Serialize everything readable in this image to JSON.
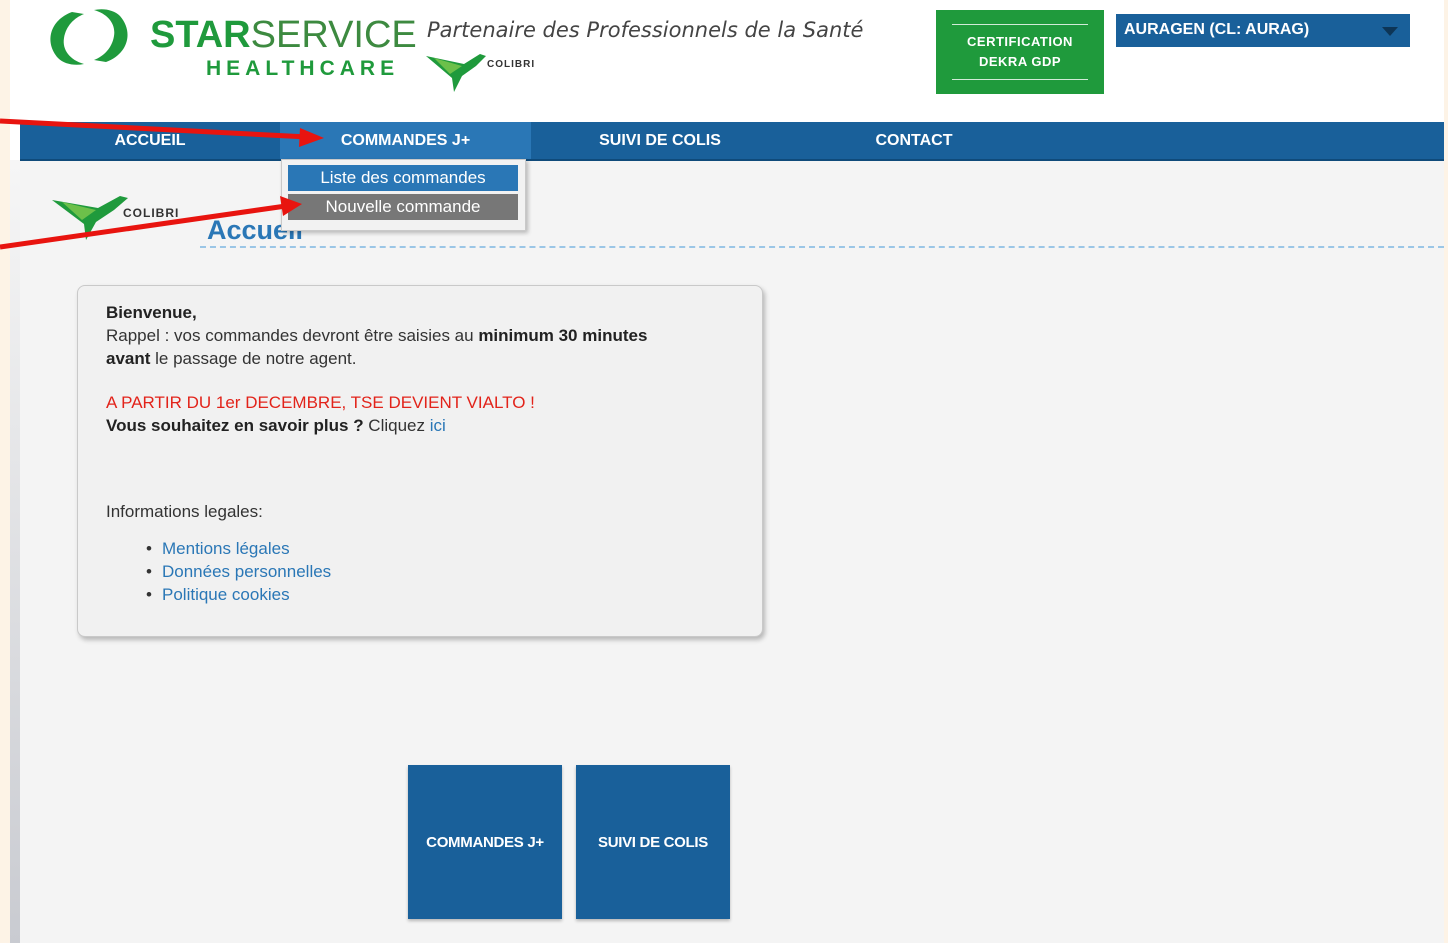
{
  "header": {
    "brand_star": "STAR",
    "brand_service": "SERVICE",
    "brand_healthcare": "HEALTHCARE",
    "tagline": "Partenaire des Professionnels de la Santé",
    "colibri_label": "COLIBRI",
    "certification_line1": "CERTIFICATION",
    "certification_line2": "DEKRA GDP",
    "account_selector": "AURAGEN (CL: AURAG)"
  },
  "nav": {
    "items": [
      {
        "label": "ACCUEIL"
      },
      {
        "label": "COMMANDES J+"
      },
      {
        "label": "SUIVI DE COLIS"
      },
      {
        "label": "CONTACT"
      }
    ],
    "dropdown": [
      {
        "label": "Liste des commandes"
      },
      {
        "label": "Nouvelle commande"
      }
    ]
  },
  "page": {
    "colibri_label": "COLIBRI",
    "title": "Accueil"
  },
  "welcome": {
    "greeting": "Bienvenue,",
    "reminder_prefix": "Rappel : vos commandes devront être saisies au ",
    "reminder_bold": "minimum 30 minutes",
    "reminder_bold2": "avant",
    "reminder_suffix": " le passage de notre agent.",
    "announcement": "A PARTIR DU 1er DECEMBRE, TSE DEVIENT VIALTO !",
    "more_bold": "Vous souhaitez en savoir plus ?",
    "more_text": " Cliquez ",
    "more_link": "ici",
    "legal_heading": "Informations legales:",
    "legal_links": [
      "Mentions légales",
      "Données personnelles",
      "Politique cookies"
    ]
  },
  "tiles": [
    {
      "label": "COMMANDES J+"
    },
    {
      "label": "SUIVI DE COLIS"
    }
  ],
  "colors": {
    "brand_green": "#1f9a3c",
    "nav_blue": "#19609a",
    "active_blue": "#2a77b6",
    "annotation_red": "#e8140f"
  }
}
